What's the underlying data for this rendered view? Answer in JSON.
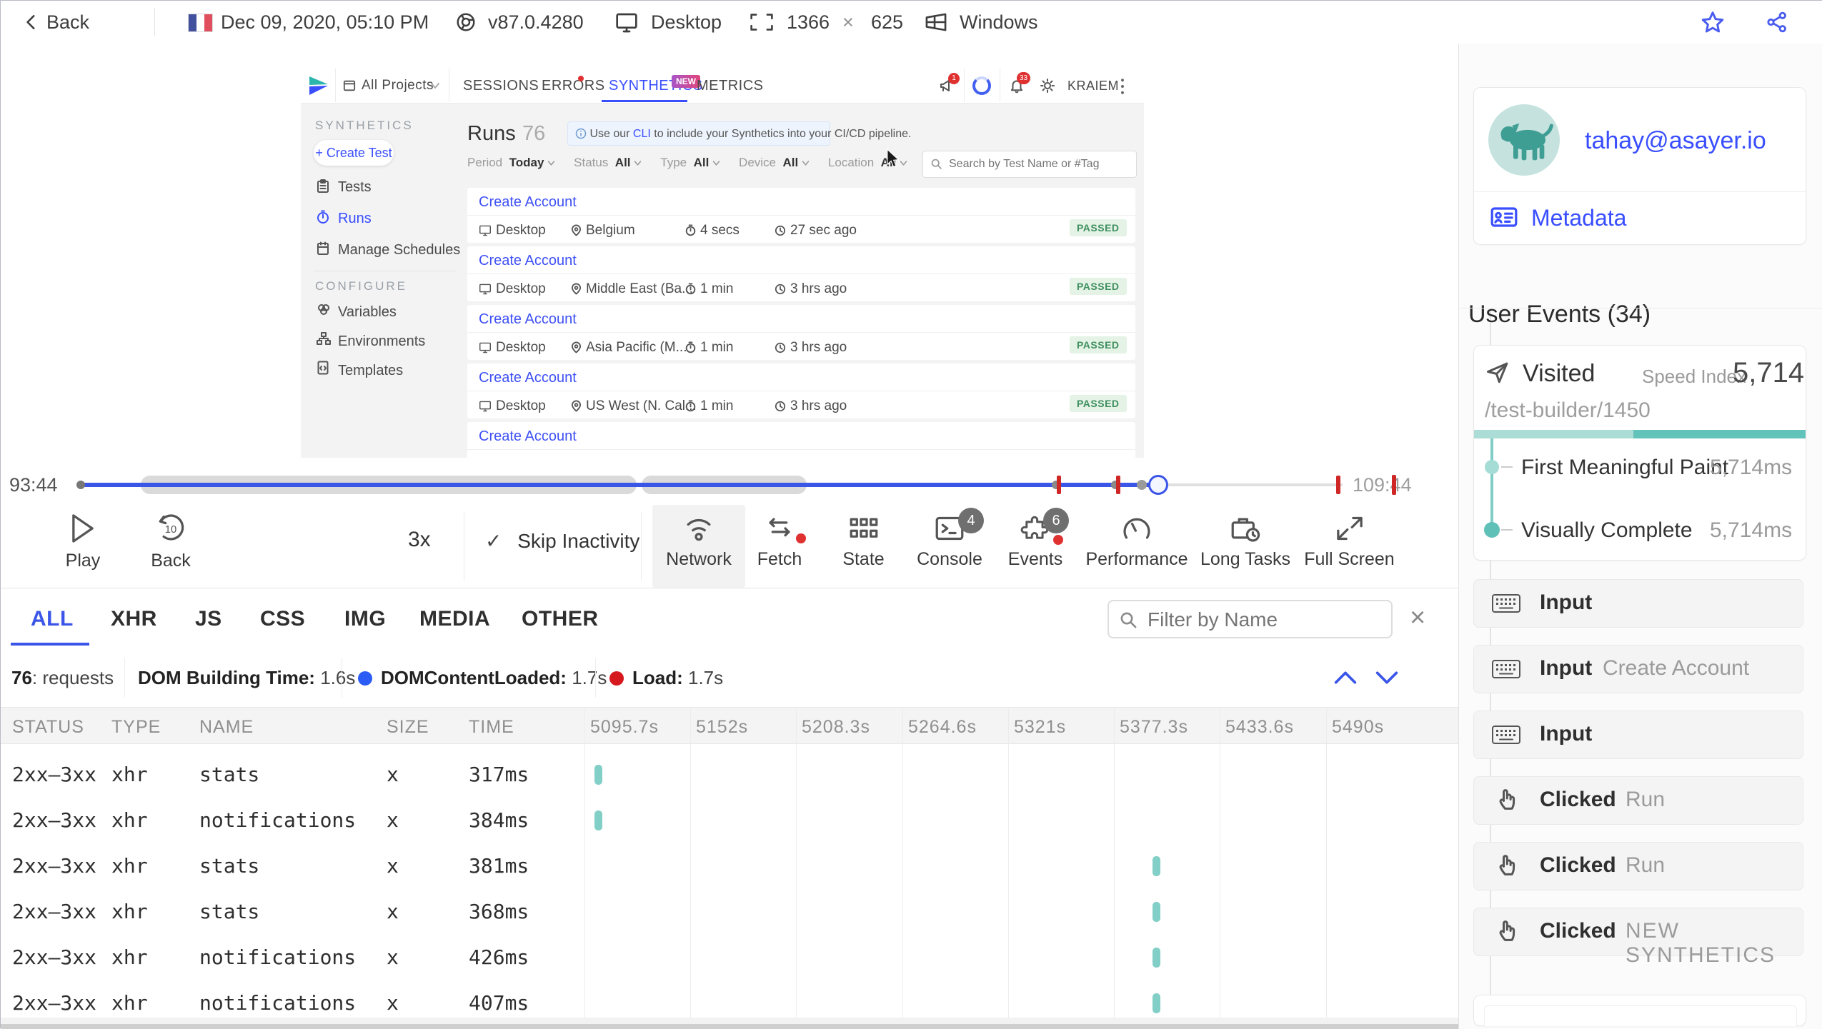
{
  "topbar": {
    "back_label": "Back",
    "date": "Dec 09, 2020, 05:10 PM",
    "browser_version": "v87.0.4280",
    "device": "Desktop",
    "resolution_w": "1366",
    "resolution_x": "×",
    "resolution_h": "625",
    "os": "Windows"
  },
  "app": {
    "project_selector": "All Projects",
    "tabs": {
      "sessions": "SESSIONS",
      "errors": "ERRORS",
      "synthetics": "SYNTHETICS",
      "synthetics_badge": "NEW",
      "metrics": "METRICS"
    },
    "user_menu": "KRAIEM",
    "promo_badge": "1",
    "notif_badge": "33",
    "sidebar": {
      "section1": "SYNTHETICS",
      "create_button": "+ Create Test",
      "items": {
        "0": "Tests",
        "1": "Runs",
        "2": "Manage Schedules"
      },
      "section2": "CONFIGURE",
      "config": {
        "0": "Variables",
        "1": "Environments",
        "2": "Templates"
      }
    },
    "runs": {
      "title": "Runs",
      "count": "76",
      "banner_prefix": "Use our ",
      "banner_link": "CLI",
      "banner_suffix": " to include your Synthetics into your CI/CD pipeline.",
      "filters": [
        {
          "label": "Period",
          "value": "Today"
        },
        {
          "label": "Status",
          "value": "All"
        },
        {
          "label": "Type",
          "value": "All"
        },
        {
          "label": "Device",
          "value": "All"
        },
        {
          "label": "Location",
          "value": "All"
        }
      ],
      "search_placeholder": "Search by Test Name or #Tag",
      "rows": [
        {
          "name": "Create Account",
          "device": "Desktop",
          "location": "Belgium",
          "duration": "4 secs",
          "ago": "27 sec ago",
          "status": "PASSED"
        },
        {
          "name": "Create Account",
          "device": "Desktop",
          "location": "Middle East (Ba...",
          "duration": "1 min",
          "ago": "3 hrs ago",
          "status": "PASSED"
        },
        {
          "name": "Create Account",
          "device": "Desktop",
          "location": "Asia Pacific (M...",
          "duration": "1 min",
          "ago": "3 hrs ago",
          "status": "PASSED"
        },
        {
          "name": "Create Account",
          "device": "Desktop",
          "location": "US West (N. Cal...",
          "duration": "1 min",
          "ago": "3 hrs ago",
          "status": "PASSED"
        },
        {
          "name": "Create Account",
          "device": "",
          "location": "",
          "duration": "",
          "ago": "",
          "status": ""
        }
      ]
    }
  },
  "timeline": {
    "start": "93:44",
    "end": "109:44"
  },
  "controls": {
    "play": "Play",
    "back": "Back",
    "back_amount": "10",
    "speed": "3x",
    "skip_check": "✓",
    "skip_label": "Skip Inactivity",
    "panels": [
      {
        "label": "Network"
      },
      {
        "label": "Fetch"
      },
      {
        "label": "State"
      },
      {
        "label": "Console",
        "badge": "4"
      },
      {
        "label": "Events",
        "badge": "6"
      },
      {
        "label": "Performance"
      },
      {
        "label": "Long Tasks"
      },
      {
        "label": "Full Screen"
      }
    ]
  },
  "network": {
    "tabs": {
      "0": "ALL",
      "1": "XHR",
      "2": "JS",
      "3": "CSS",
      "4": "IMG",
      "5": "MEDIA",
      "6": "OTHER"
    },
    "filter_placeholder": "Filter by Name",
    "close": "×",
    "stats": {
      "count": "76",
      "count_label": ": requests",
      "dom_label": "DOM Building Time:",
      "dom_value": "1.6s",
      "dcl_label": "DOMContentLoaded:",
      "dcl_value": "1.7s",
      "load_label": "Load:",
      "load_value": "1.7s"
    },
    "headers": {
      "status": "STATUS",
      "type": "TYPE",
      "name": "NAME",
      "size": "SIZE",
      "time": "TIME"
    },
    "time_columns": [
      "5095.7s",
      "5152s",
      "5208.3s",
      "5264.6s",
      "5321s",
      "5377.3s",
      "5433.6s",
      "5490s"
    ],
    "rows": [
      {
        "status": "2xx–3xx",
        "type": "xhr",
        "name": "stats",
        "size": "x",
        "time": "317ms"
      },
      {
        "status": "2xx–3xx",
        "type": "xhr",
        "name": "notifications",
        "size": "x",
        "time": "384ms"
      },
      {
        "status": "2xx–3xx",
        "type": "xhr",
        "name": "stats",
        "size": "x",
        "time": "381ms"
      },
      {
        "status": "2xx–3xx",
        "type": "xhr",
        "name": "stats",
        "size": "x",
        "time": "368ms"
      },
      {
        "status": "2xx–3xx",
        "type": "xhr",
        "name": "notifications",
        "size": "x",
        "time": "426ms"
      },
      {
        "status": "2xx–3xx",
        "type": "xhr",
        "name": "notifications",
        "size": "x",
        "time": "407ms"
      }
    ]
  },
  "user_panel": {
    "email": "tahay@asayer.io",
    "metadata_label": "Metadata",
    "events_title": "User Events (34)",
    "visited": {
      "label": "Visited",
      "speed_index_label": "Speed Index",
      "speed_index": "5,714",
      "url": "/test-builder/1450",
      "metrics": [
        {
          "label": "First Meaningful Paint",
          "value": "5,714ms"
        },
        {
          "label": "Visually Complete",
          "value": "5,714ms"
        }
      ]
    },
    "events": [
      {
        "type": "Input",
        "value": ""
      },
      {
        "type": "Input",
        "value": "Create Account"
      },
      {
        "type": "Input",
        "value": ""
      },
      {
        "type": "Clicked",
        "value": "Run"
      },
      {
        "type": "Clicked",
        "value": "Run"
      },
      {
        "type": "Clicked",
        "value": "NEW SYNTHETICS"
      }
    ]
  }
}
